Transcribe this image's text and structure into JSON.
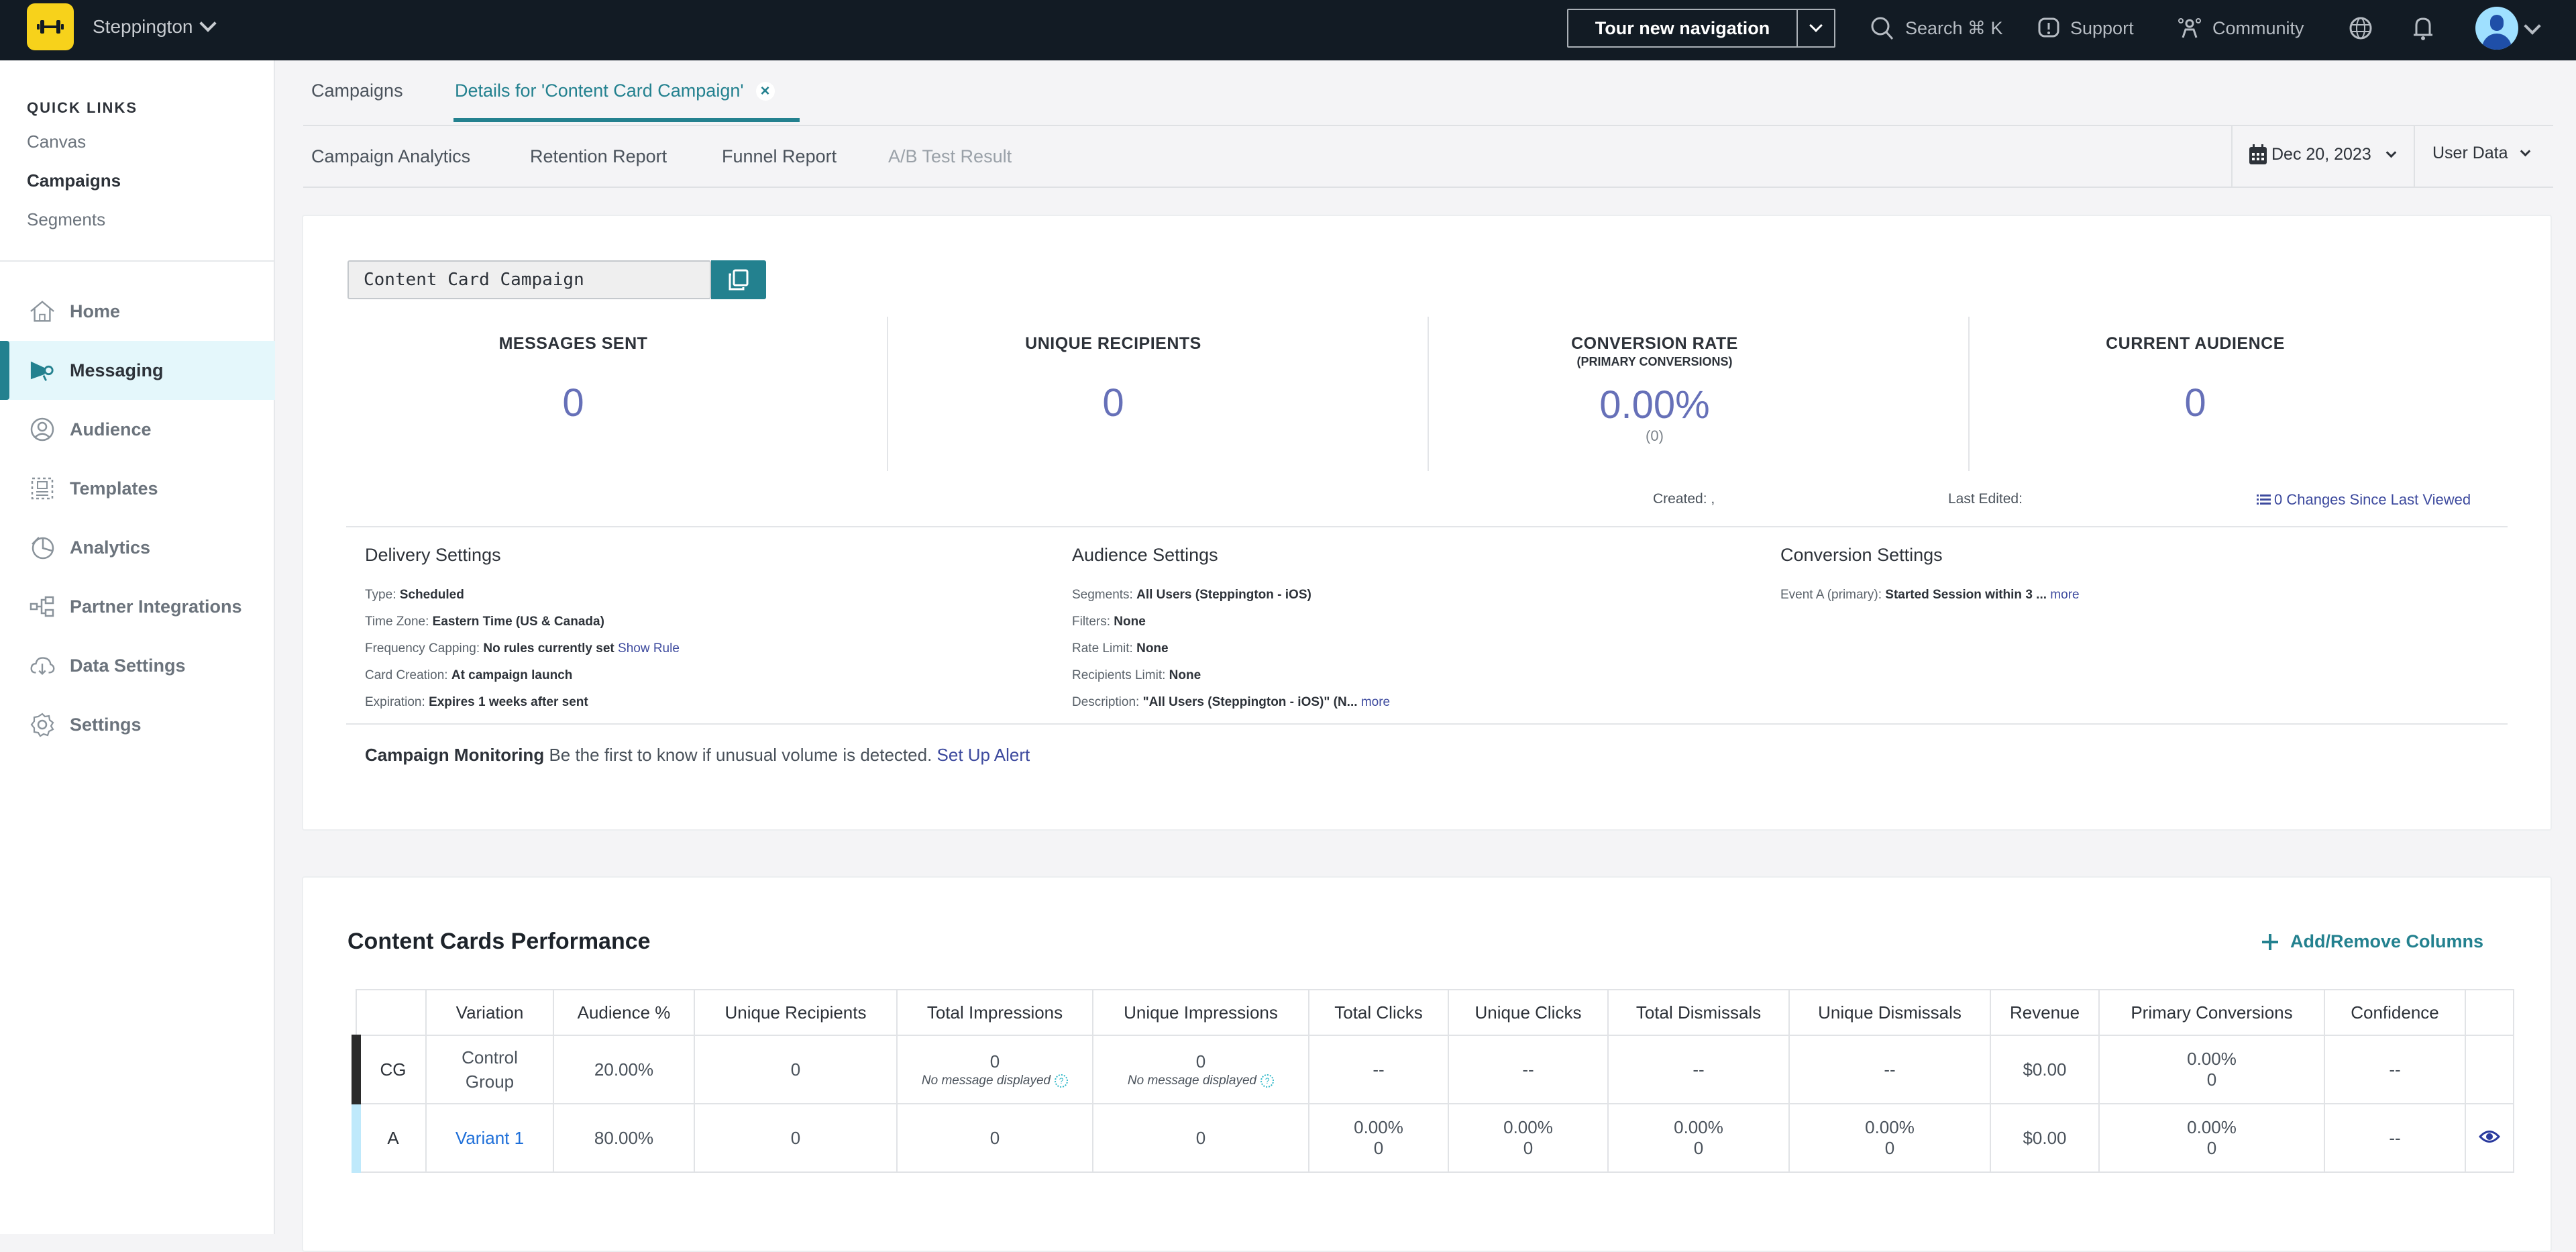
{
  "topbar": {
    "brand": "Steppington",
    "tour_label": "Tour new navigation",
    "search_label": "Search ⌘ K",
    "support_label": "Support",
    "community_label": "Community"
  },
  "sidebar": {
    "quick_links_title": "QUICK LINKS",
    "quick_links": [
      {
        "label": "Canvas"
      },
      {
        "label": "Campaigns"
      },
      {
        "label": "Segments"
      }
    ],
    "items": [
      {
        "label": "Home",
        "icon": "home-icon"
      },
      {
        "label": "Messaging",
        "icon": "megaphone-icon"
      },
      {
        "label": "Audience",
        "icon": "audience-icon"
      },
      {
        "label": "Templates",
        "icon": "templates-icon"
      },
      {
        "label": "Analytics",
        "icon": "pie-chart-icon"
      },
      {
        "label": "Partner Integrations",
        "icon": "integrations-icon"
      },
      {
        "label": "Data Settings",
        "icon": "cloud-download-icon"
      },
      {
        "label": "Settings",
        "icon": "gear-icon"
      }
    ]
  },
  "tabs": {
    "primary": [
      {
        "label": "Campaigns"
      },
      {
        "label": "Details for 'Content Card Campaign'"
      }
    ],
    "secondary": [
      {
        "label": "Campaign Analytics"
      },
      {
        "label": "Retention Report"
      },
      {
        "label": "Funnel Report"
      },
      {
        "label": "A/B Test Result"
      }
    ],
    "date": "Dec 20, 2023",
    "data_type": "User Data"
  },
  "campaign": {
    "name": "Content Card Campaign",
    "stats": [
      {
        "title": "MESSAGES SENT",
        "value": "0"
      },
      {
        "title": "UNIQUE RECIPIENTS",
        "value": "0"
      },
      {
        "title": "CONVERSION RATE",
        "subtitle": "(PRIMARY CONVERSIONS)",
        "value": "0.00%",
        "count": "(0)"
      },
      {
        "title": "CURRENT AUDIENCE",
        "value": "0"
      }
    ],
    "created_label": "Created: ,",
    "last_edited_label": "Last Edited:",
    "changes_link": "0 Changes Since Last Viewed",
    "delivery": {
      "title": "Delivery Settings",
      "rows": [
        {
          "label": "Type:",
          "value": "Scheduled"
        },
        {
          "label": "Time Zone:",
          "value": "Eastern Time (US & Canada)"
        },
        {
          "label": "Frequency Capping:",
          "value": "No rules currently set",
          "link": "Show Rule"
        },
        {
          "label": "Card Creation:",
          "value": "At campaign launch"
        },
        {
          "label": "Expiration:",
          "value": "Expires 1 weeks after sent"
        }
      ]
    },
    "audience": {
      "title": "Audience Settings",
      "rows": [
        {
          "label": "Segments:",
          "value": "All Users (Steppington - iOS)"
        },
        {
          "label": "Filters:",
          "value": "None"
        },
        {
          "label": "Rate Limit:",
          "value": "None"
        },
        {
          "label": "Recipients Limit:",
          "value": "None"
        },
        {
          "label": "Description:",
          "value": "\"All Users (Steppington - iOS)\" (N...",
          "link": "more"
        }
      ]
    },
    "conversion": {
      "title": "Conversion Settings",
      "rows": [
        {
          "label": "Event A (primary):",
          "value": "Started Session within 3 ...",
          "link": "more"
        }
      ]
    },
    "monitoring": {
      "title": "Campaign Monitoring",
      "text": "Be the first to know if unusual volume is detected.",
      "link": "Set Up Alert"
    }
  },
  "performance": {
    "title": "Content Cards Performance",
    "add_remove_label": "Add/Remove Columns",
    "columns": [
      "",
      "Variation",
      "Audience %",
      "Unique Recipients",
      "Total Impressions",
      "Unique Impressions",
      "Total Clicks",
      "Unique Clicks",
      "Total Dismissals",
      "Unique Dismissals",
      "Revenue",
      "Primary Conversions",
      "Confidence",
      ""
    ],
    "rows": [
      {
        "key": "CG",
        "variation": "Control Group",
        "audience_pct": "20.00%",
        "unique_recipients": "0",
        "total_impressions": "0",
        "total_impressions_note": "No message displayed",
        "unique_impressions": "0",
        "unique_impressions_note": "No message displayed",
        "total_clicks": "--",
        "unique_clicks": "--",
        "total_dismissals": "--",
        "unique_dismissals": "--",
        "revenue": "$0.00",
        "primary_conversions_pct": "0.00%",
        "primary_conversions": "0",
        "confidence": "--"
      },
      {
        "key": "A",
        "variation": "Variant 1",
        "audience_pct": "80.00%",
        "unique_recipients": "0",
        "total_impressions": "0",
        "unique_impressions": "0",
        "total_clicks_pct": "0.00%",
        "total_clicks": "0",
        "unique_clicks_pct": "0.00%",
        "unique_clicks": "0",
        "total_dismissals_pct": "0.00%",
        "total_dismissals": "0",
        "unique_dismissals_pct": "0.00%",
        "unique_dismissals": "0",
        "revenue": "$0.00",
        "primary_conversions_pct": "0.00%",
        "primary_conversions": "0",
        "confidence": "--"
      }
    ]
  },
  "colors": {
    "accent": "#23818f",
    "link": "#3d4a9e",
    "stat_value": "#6670b8",
    "topbar": "#121b24",
    "logo": "#f7d21b"
  }
}
